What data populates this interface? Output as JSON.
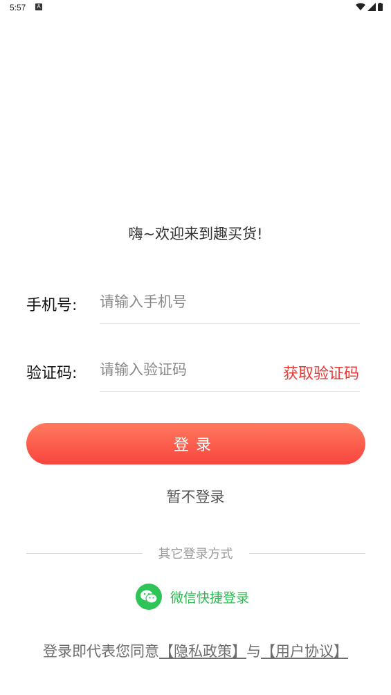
{
  "status": {
    "time": "5:57",
    "notif_icon": "A"
  },
  "welcome": "嗨~欢迎来到趣买货!",
  "phone": {
    "label": "手机号:",
    "placeholder": "请输入手机号"
  },
  "code": {
    "label": "验证码:",
    "placeholder": "请输入验证码",
    "get_code": "获取验证码"
  },
  "login_button": "登录",
  "skip_login": "暂不登录",
  "other_login": "其它登录方式",
  "wechat_login": "微信快捷登录",
  "agreement": {
    "prefix": "登录即代表您同意",
    "privacy": "【隐私政策】",
    "and": "与",
    "user": "【用户协议】"
  },
  "colors": {
    "accent": "#f8453e",
    "get_code": "#e83a36",
    "wechat": "#2fc458"
  },
  "icons": [
    "wifi-icon",
    "signal-icon",
    "battery-icon",
    "wechat-icon"
  ]
}
